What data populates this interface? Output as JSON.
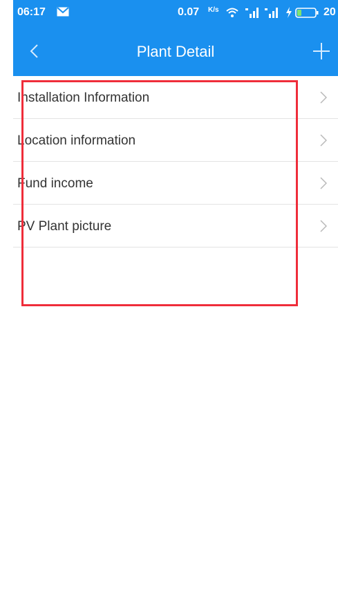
{
  "status_bar": {
    "time": "06:17",
    "net_speed": "0.07",
    "net_unit": "K/s",
    "battery": "20"
  },
  "header": {
    "title": "Plant Detail",
    "back_icon": "chevron-left-icon",
    "add_icon": "plus-icon"
  },
  "list": [
    {
      "label": "Installation Information"
    },
    {
      "label": "Location information"
    },
    {
      "label": "Fund income"
    },
    {
      "label": "PV Plant picture"
    }
  ],
  "colors": {
    "accent": "#1a90ef",
    "highlight": "#ef2d3a"
  }
}
